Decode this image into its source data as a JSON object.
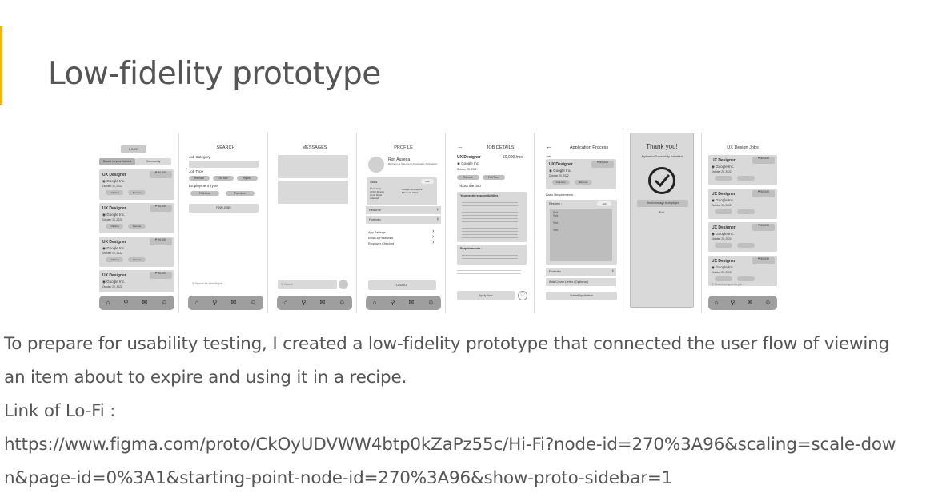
{
  "page": {
    "title": "Low-fidelity prototype",
    "paragraph_line1": "To prepare for usability testing, I created a low-fidelity prototype that connected the user flow of viewing",
    "paragraph_line2": "an item about to expire and using it in a recipe.",
    "link_label": "Link of Lo-Fi :",
    "link_url_line1": "https://www.figma.com/proto/CkOyUDVWW4btp0kZaPz55c/Hi-Fi?node-id=270%3A96&scaling=scale-dow",
    "link_url_line2": "n&page-id=0%3A1&starting-point-node-id=270%3A96&show-proto-sidebar=1"
  },
  "wireframes": {
    "home": {
      "logo": "LOGO",
      "tab_active": "Based on your interest",
      "tab_other": "Community",
      "job_title": "UX Designer",
      "company": "Google Inc.",
      "date": "October 20, 2022",
      "salary": "₱ 50,000",
      "salary_unit": "/mo",
      "tag1": "Full-time",
      "tag2": "Remote"
    },
    "search": {
      "header": "SEARCH",
      "job_category": "Job Category",
      "job_type": "Job Type",
      "type1": "Remote",
      "type2": "On site",
      "type3": "Hybrid",
      "employment_type": "Employment Type",
      "emp1": "Full-time",
      "emp2": "Part-time",
      "find_jobs": "FIND JOBS",
      "search_placeholder": "Search for specific job..."
    },
    "messages": {
      "header": "MESSAGES",
      "search_placeholder": "Search"
    },
    "profile": {
      "header": "PROFILE",
      "name": "Ron Ausena",
      "degree": "Bachelor of Science in Information Technology",
      "skills": "Skills",
      "edit": "edit",
      "skill1": "Photoshop",
      "skill2": "UI/UX Design",
      "skill3": "Corel Draw",
      "skill4": "Autocad",
      "skill5": "Google Workspace",
      "skill6": "Microsoft Office",
      "resume": "Resume",
      "portfolio": "Portfolio",
      "app_settings": "App Settings",
      "email_password": "Email & Password",
      "employer_checked": "Employer Checked",
      "logout": "LOGOUT"
    },
    "job_details": {
      "header": "JOB DETAILS",
      "job_title": "UX Designer",
      "salary": "50,000 /mo.",
      "company": "Google Inc.",
      "date": "October 20, 2022",
      "tag1": "Remote",
      "tag2": "Full Time",
      "about": "About the Job",
      "responsibilities": "Your work responsibilities :",
      "requirements": "Requirements :",
      "apply": "Apply Now"
    },
    "application": {
      "header": "Application Process",
      "job_label": "Job",
      "job_title": "UX Designer",
      "company": "Google Inc.",
      "date": "October 20, 2022",
      "salary": "₱ 50,000",
      "tag1": "Full-time",
      "tag2": "Remote",
      "basic_requirements": "Basic Requirements",
      "resume": "Resume :",
      "edit": "edit",
      "text": "Text",
      "portfolio": "Portfolio",
      "cover_letter": "Add Cover Letter (Optional)",
      "submit": "Submit Application"
    },
    "thank_you": {
      "title": "Thank you!",
      "subtitle": "Application Successfully Submitted",
      "send_message": "Send message to employer",
      "exit": "Exit"
    },
    "ux_jobs": {
      "header": "UX Design Jobs",
      "job_title": "UX Designer",
      "company": "Google Inc.",
      "date": "October 20, 2022",
      "salary": "₱ 50,000",
      "search_placeholder": "Search for specific job..."
    }
  }
}
